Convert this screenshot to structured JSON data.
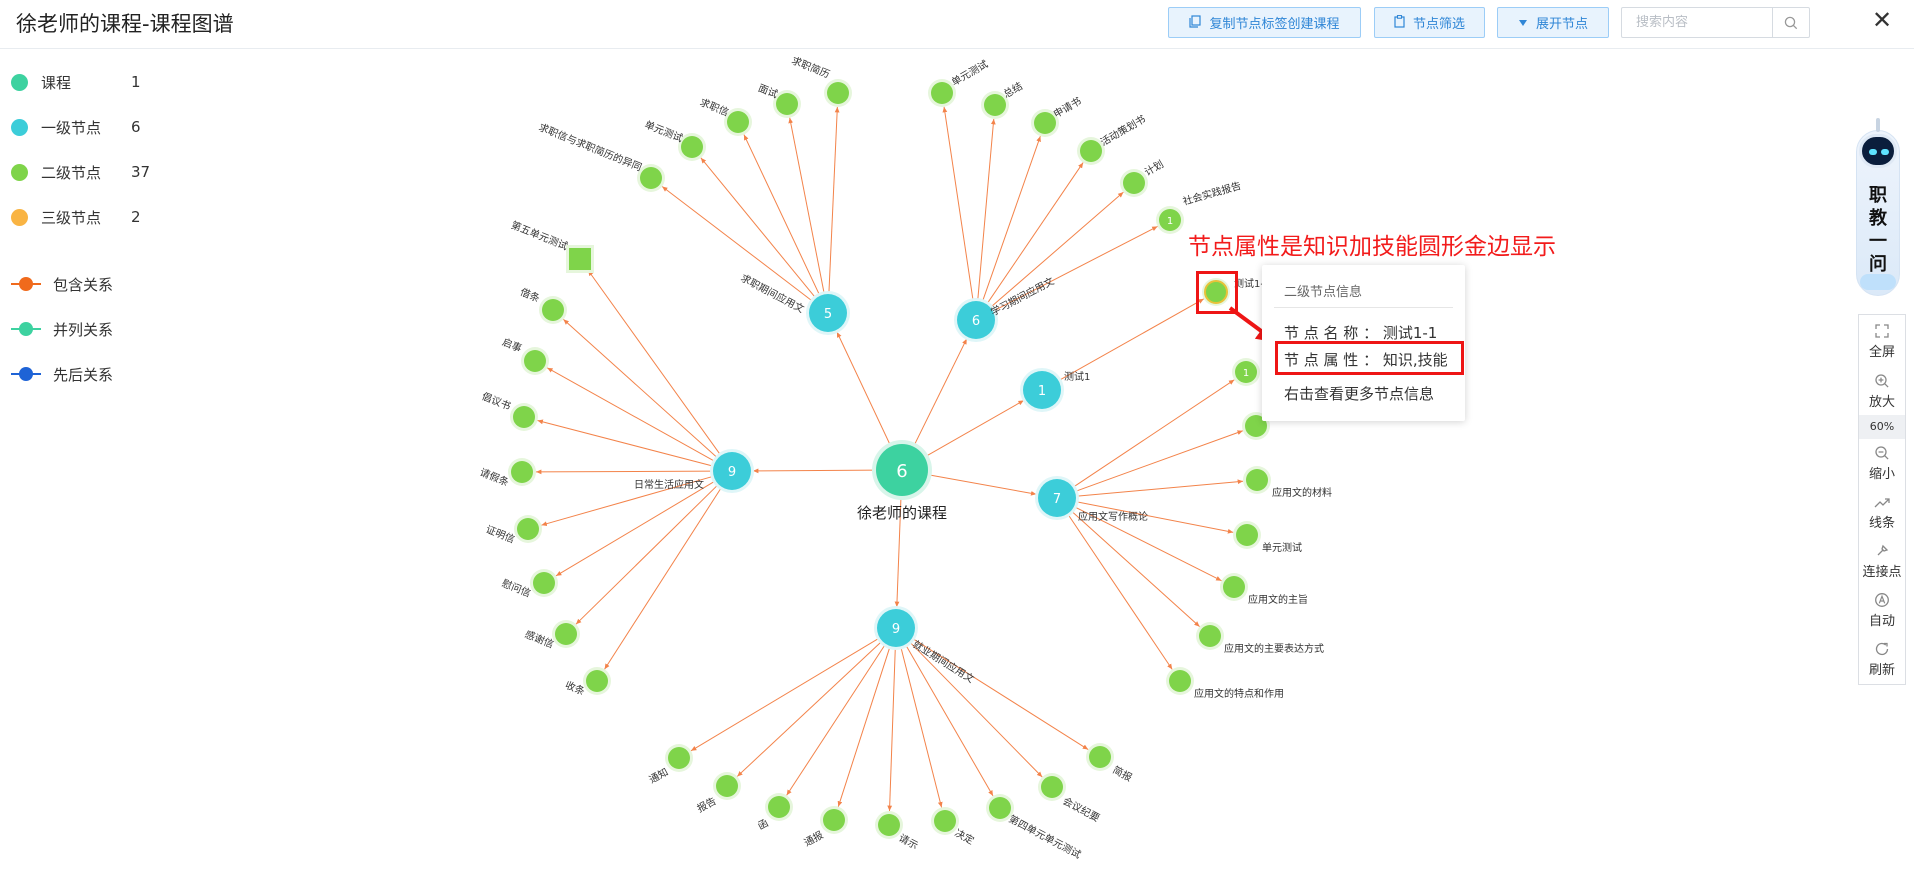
{
  "header": {
    "title": "徐老师的课程-课程图谱",
    "buttons": {
      "copy_label": "复制节点标签创建课程",
      "filter_label": "节点筛选",
      "expand_label": "展开节点"
    },
    "search_placeholder": "搜索内容",
    "close_label": "✕"
  },
  "legend": {
    "node_types": [
      {
        "label": "课程",
        "count": "1",
        "color": "#3dd2a0"
      },
      {
        "label": "一级节点",
        "count": "6",
        "color": "#3ccdd9"
      },
      {
        "label": "二级节点",
        "count": "37",
        "color": "#7fd44a"
      },
      {
        "label": "三级节点",
        "count": "2",
        "color": "#f9b443"
      }
    ],
    "relations": [
      {
        "label": "包含关系",
        "color": "#f06a1c"
      },
      {
        "label": "并列关系",
        "color": "#3dd2a0"
      },
      {
        "label": "先后关系",
        "color": "#1e63d6"
      }
    ]
  },
  "graph": {
    "root": {
      "id": "root",
      "count": "6",
      "label": "徐老师的课程"
    },
    "nodes": [
      {
        "id": "n1",
        "count": "5",
        "label": "求职期间应用文"
      },
      {
        "id": "n2",
        "count": "6",
        "label": "学习期间应用文"
      },
      {
        "id": "n3",
        "count": "1",
        "label": "测试1"
      },
      {
        "id": "n4",
        "count": "7",
        "label": "应用文写作概论"
      },
      {
        "id": "n5",
        "count": "9",
        "label": "就业期间应用文"
      },
      {
        "id": "n6",
        "count": "9",
        "label": "日常生活应用文"
      }
    ],
    "leaves": [
      {
        "id": "l1",
        "label": "求职信与求职简历的异同"
      },
      {
        "id": "l2",
        "label": "单元测试"
      },
      {
        "id": "l3",
        "label": "求职信"
      },
      {
        "id": "l4",
        "label": "面试"
      },
      {
        "id": "l5",
        "label": "求职简历"
      },
      {
        "id": "l6",
        "label": "单元测试"
      },
      {
        "id": "l7",
        "label": "总结"
      },
      {
        "id": "l8",
        "label": "申请书"
      },
      {
        "id": "l9",
        "label": "活动策划书"
      },
      {
        "id": "l10",
        "label": "计划"
      },
      {
        "id": "l11",
        "label": "社会实践报告",
        "count": "1"
      },
      {
        "id": "l12",
        "label": "测试1-1"
      },
      {
        "id": "l13",
        "label": "",
        "count": "1"
      },
      {
        "id": "l14",
        "label": ""
      },
      {
        "id": "l15",
        "label": "应用文的材料"
      },
      {
        "id": "l16",
        "label": "单元测试"
      },
      {
        "id": "l17",
        "label": "应用文的主旨"
      },
      {
        "id": "l18",
        "label": "应用文的主要表达方式"
      },
      {
        "id": "l19",
        "label": "应用文的特点和作用"
      },
      {
        "id": "l20",
        "label": "简报"
      },
      {
        "id": "l21",
        "label": "会议纪要"
      },
      {
        "id": "l22",
        "label": "第四单元单元测试"
      },
      {
        "id": "l23",
        "label": "决定"
      },
      {
        "id": "l24",
        "label": "请示"
      },
      {
        "id": "l25",
        "label": "通报"
      },
      {
        "id": "l26",
        "label": "函"
      },
      {
        "id": "l27",
        "label": "报告"
      },
      {
        "id": "l28",
        "label": "通知"
      },
      {
        "id": "l29",
        "label": "第五单元测试"
      },
      {
        "id": "l30",
        "label": "借条"
      },
      {
        "id": "l31",
        "label": "启事"
      },
      {
        "id": "l32",
        "label": "倡议书"
      },
      {
        "id": "l33",
        "label": "请假条"
      },
      {
        "id": "l34",
        "label": "证明信"
      },
      {
        "id": "l35",
        "label": "慰问信"
      },
      {
        "id": "l36",
        "label": "感谢信"
      },
      {
        "id": "l37",
        "label": "收条"
      }
    ]
  },
  "annotation": {
    "text": "节点属性是知识加技能圆形金边显示"
  },
  "tooltip": {
    "title": "二级节点信息",
    "name_line": "节 点 名 称 ： 测试1-1",
    "attr_line": "节 点 属 性 ： 知识,技能",
    "more_line": "右击查看更多节点信息"
  },
  "assistant": {
    "text": [
      "职",
      "教",
      "一",
      "问"
    ]
  },
  "toolbar": {
    "fullscreen": "全屏",
    "zoom_in": "放大",
    "zoom_level": "60%",
    "zoom_out": "缩小",
    "lines": "线条",
    "connect": "连接点",
    "auto": "自动",
    "refresh": "刷新"
  },
  "colors": {
    "course": "#3dd2a0",
    "level1": "#3ccdd9",
    "level2": "#7fd44a",
    "edge": "#f3834a",
    "highlight": "#ee1515",
    "accent": "#2f86d6"
  }
}
